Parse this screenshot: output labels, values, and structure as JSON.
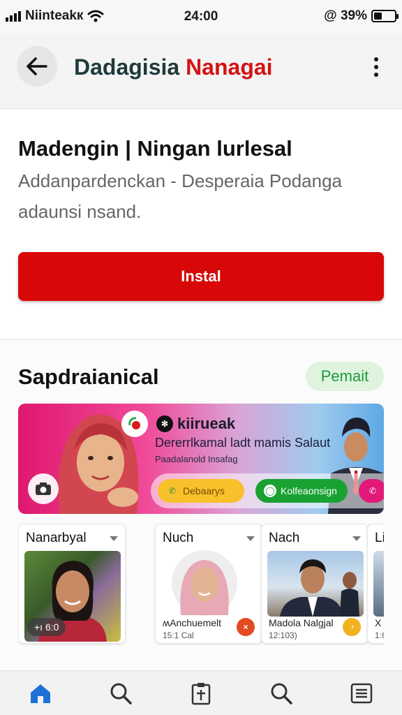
{
  "status_bar": {
    "carrier": "Niinteakк",
    "time": "24:00",
    "battery_text": "@ 39%",
    "battery_level": 0.39
  },
  "app_bar": {
    "title_part1": "Dadagisia",
    "title_part2": "Nanagai",
    "back_icon": "arrow-left-icon",
    "more_icon": "more-vertical-icon"
  },
  "hero": {
    "title": "Madengin | Ningan lurlesal",
    "description": "Addanpardenckan - Desperaia Podanga adaunsi nsand.",
    "install_label": "Instal"
  },
  "section": {
    "title": "Sapdraianical",
    "badge": "Pemait",
    "banner": {
      "brand": "kiirueak",
      "headline": "Dererrlkamal ladt mamis Salaut",
      "subline": "Paadalanold Insafag",
      "pill_yellow": "Debaarys",
      "pill_green": "Kolfeaonsign"
    },
    "cards": [
      {
        "title": "Nanarbyal",
        "chip": "+ı 6:0",
        "meta": "",
        "meta_sub": ""
      },
      {
        "title": "Nuch",
        "chip": "",
        "meta": "ʍAnchuemelt",
        "meta_sub": "15:1 Cal"
      },
      {
        "title": "Nach",
        "chip": "",
        "meta": "Madola Nalgjal",
        "meta_sub": "12:103)"
      },
      {
        "title": "Li",
        "chip": "",
        "meta": "X",
        "meta_sub": "1:6"
      }
    ]
  },
  "bottom_nav": [
    {
      "icon": "home-icon",
      "active": true
    },
    {
      "icon": "search-icon",
      "active": false
    },
    {
      "icon": "clipboard-icon",
      "active": false
    },
    {
      "icon": "search-icon",
      "active": false
    },
    {
      "icon": "list-icon",
      "active": false
    }
  ],
  "colors": {
    "accent_red": "#d80808",
    "title_red": "#d41414",
    "active_blue": "#1f6fd8",
    "badge_green": "#1e9a3a"
  }
}
